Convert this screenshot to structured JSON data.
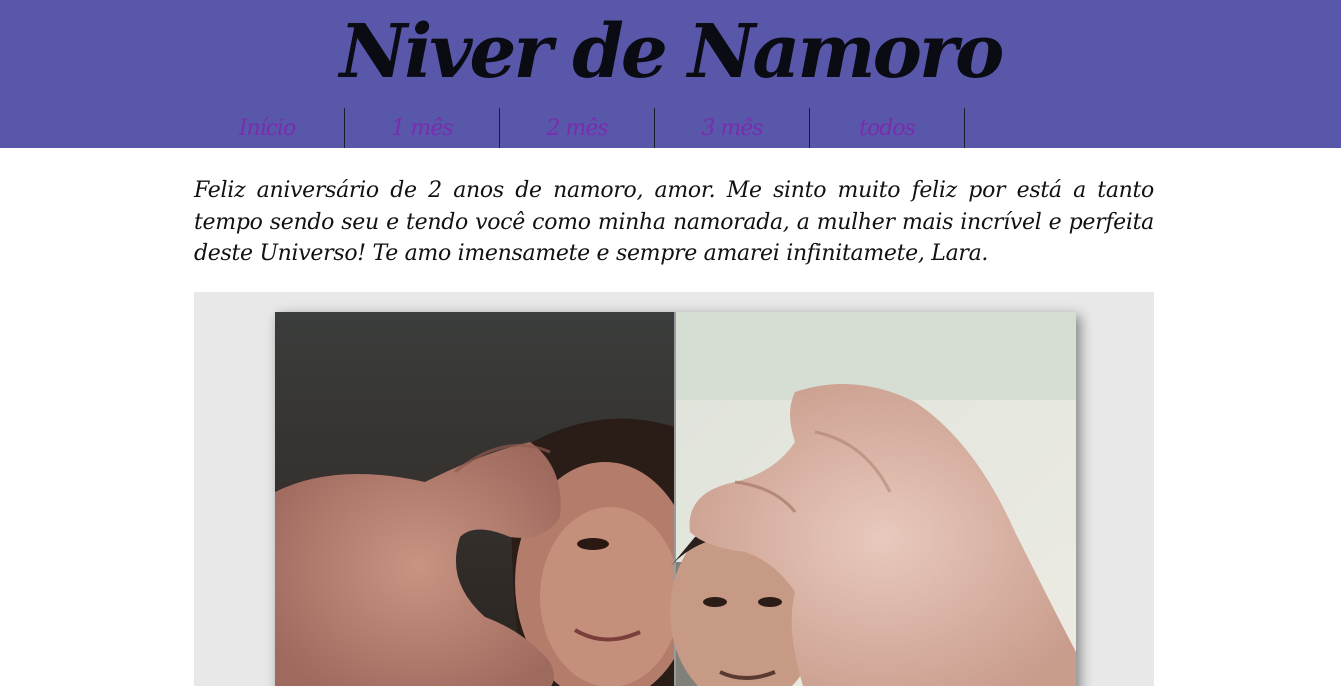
{
  "header": {
    "title": "Niver de Namoro",
    "background": "#5857aa"
  },
  "nav": {
    "items": [
      {
        "label": "Início"
      },
      {
        "label": "1 mês"
      },
      {
        "label": "2 mês"
      },
      {
        "label": "3 mês"
      },
      {
        "label": "todos"
      }
    ],
    "link_color": "#7b2cae"
  },
  "main": {
    "message": "Feliz aniversário de 2 anos de namoro, amor. Me sinto muito feliz por está a tanto tempo sendo seu e tendo você como minha namorada, a mulher mais incrível e perfeita deste Universo! Te amo imensamete e sempre amarei infinitamete, Lara."
  },
  "gallery": {
    "background": "#e8e8e8",
    "photo": "couple-heart-hands-photo"
  }
}
